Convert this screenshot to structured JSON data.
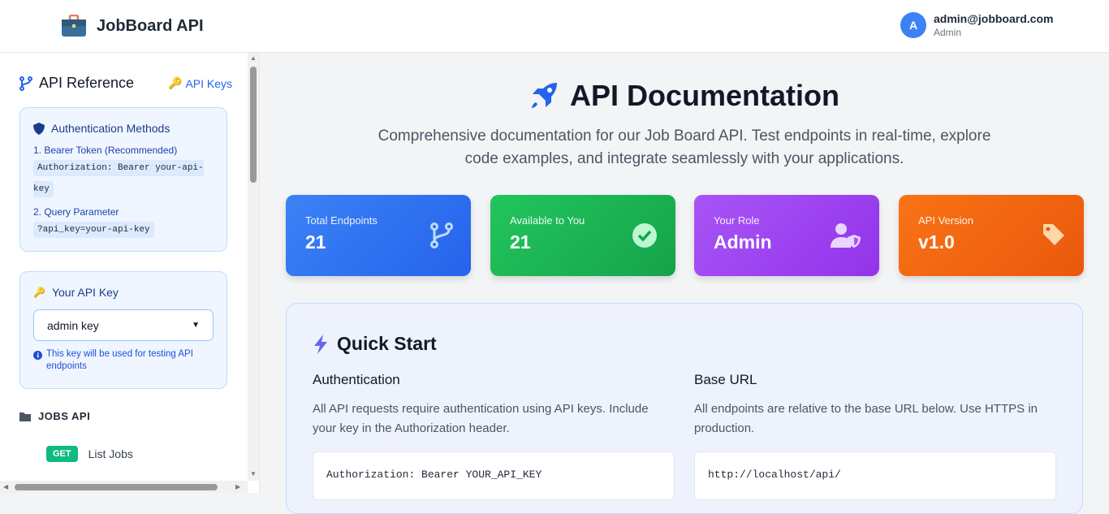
{
  "header": {
    "app_title": "JobBoard API",
    "user_initial": "A",
    "user_email": "admin@jobboard.com",
    "user_role": "Admin"
  },
  "sidebar": {
    "title": "API Reference",
    "api_keys_link": "API Keys",
    "auth": {
      "title": "Authentication Methods",
      "method1": "1. Bearer Token (Recommended)",
      "method1_code": "Authorization: Bearer your-api-key",
      "method2": "2. Query Parameter",
      "method2_code": "?api_key=your-api-key"
    },
    "key": {
      "title": "Your API Key",
      "selected": "admin key",
      "hint": "This key will be used for testing API endpoints"
    },
    "section": "JOBS API",
    "endpoints": [
      {
        "method": "GET",
        "label": "List Jobs"
      }
    ]
  },
  "main": {
    "title": "API Documentation",
    "subtitle": "Comprehensive documentation for our Job Board API. Test endpoints in real-time, explore code examples, and integrate seamlessly with your applications.",
    "stats": [
      {
        "label": "Total Endpoints",
        "value": "21",
        "color": "#2563eb"
      },
      {
        "label": "Available to You",
        "value": "21",
        "color": "#16a34a"
      },
      {
        "label": "Your Role",
        "value": "Admin",
        "color": "#9333ea"
      },
      {
        "label": "API Version",
        "value": "v1.0",
        "color": "#ea580c"
      }
    ],
    "quick_start": {
      "title": "Quick Start",
      "auth_title": "Authentication",
      "auth_text": "All API requests require authentication using API keys. Include your key in the Authorization header.",
      "auth_code": "Authorization: Bearer YOUR_API_KEY",
      "base_title": "Base URL",
      "base_text": "All endpoints are relative to the base URL below. Use HTTPS in production.",
      "base_code": "http://localhost/api/"
    }
  }
}
